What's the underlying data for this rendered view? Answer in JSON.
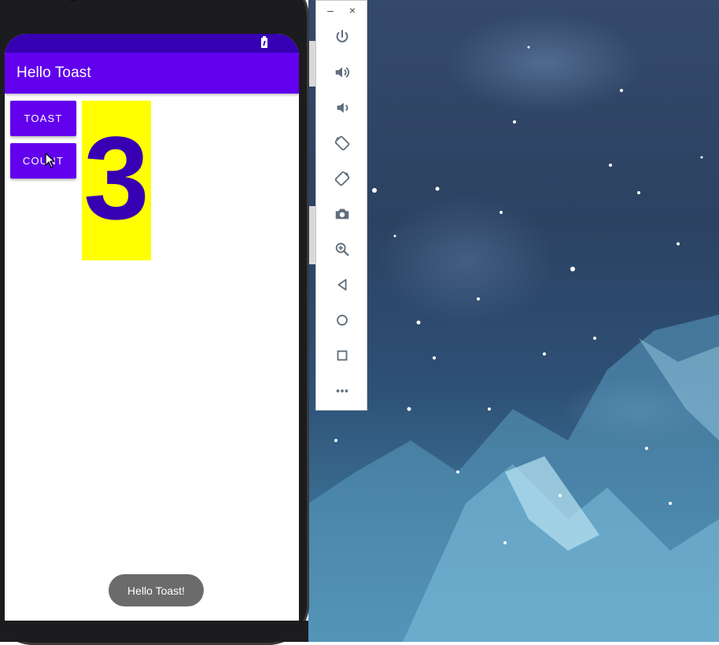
{
  "app": {
    "title": "Hello Toast",
    "toast_button_label": "TOAST",
    "count_button_label": "COUNT",
    "count_value": "3",
    "toast_message": "Hello Toast!"
  },
  "emulator_toolbar": {
    "window_controls": {
      "minimize": "–",
      "close": "×"
    },
    "buttons": [
      {
        "name": "power-icon"
      },
      {
        "name": "volume-up-icon"
      },
      {
        "name": "volume-down-icon"
      },
      {
        "name": "rotate-left-icon"
      },
      {
        "name": "rotate-right-icon"
      },
      {
        "name": "camera-icon"
      },
      {
        "name": "zoom-icon"
      },
      {
        "name": "back-icon"
      },
      {
        "name": "home-icon"
      },
      {
        "name": "overview-icon"
      },
      {
        "name": "more-icon"
      }
    ]
  },
  "colors": {
    "status_bar": "#3700b3",
    "app_bar": "#6200ee",
    "count_box": "#ffff00",
    "count_text": "#3700b3",
    "toast_bg": "#6b6b6b",
    "toolbar_icon": "#5f6e7c"
  }
}
